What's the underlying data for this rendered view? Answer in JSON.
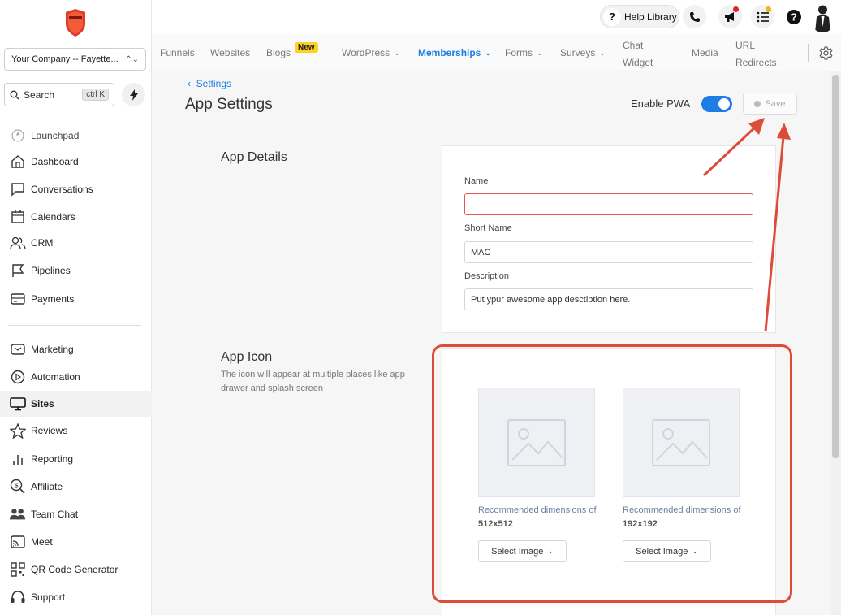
{
  "sidebar": {
    "company": "Your Company -- Fayette...",
    "search_label": "Search",
    "search_shortcut": "ctrl K",
    "items": [
      {
        "label": "Launchpad",
        "icon": "rocket-icon"
      },
      {
        "label": "Dashboard",
        "icon": "home-icon"
      },
      {
        "label": "Conversations",
        "icon": "chat-icon"
      },
      {
        "label": "Calendars",
        "icon": "calendar-icon"
      },
      {
        "label": "CRM",
        "icon": "users-icon"
      },
      {
        "label": "Pipelines",
        "icon": "flag-icon"
      },
      {
        "label": "Payments",
        "icon": "card-icon"
      },
      {
        "label": "Marketing",
        "icon": "mail-icon"
      },
      {
        "label": "Automation",
        "icon": "play-circle-icon"
      },
      {
        "label": "Sites",
        "icon": "monitor-icon",
        "active": true
      },
      {
        "label": "Reviews",
        "icon": "star-icon"
      },
      {
        "label": "Reporting",
        "icon": "bar-chart-icon"
      },
      {
        "label": "Affiliate",
        "icon": "affiliate-icon"
      },
      {
        "label": "Team Chat",
        "icon": "team-icon"
      },
      {
        "label": "Meet",
        "icon": "cast-icon"
      },
      {
        "label": "QR Code Generator",
        "icon": "qr-icon"
      },
      {
        "label": "Support",
        "icon": "headset-icon"
      }
    ]
  },
  "header": {
    "help_label": "Help Library"
  },
  "tabs": [
    {
      "label": "Funnels"
    },
    {
      "label": "Websites"
    },
    {
      "label": "Blogs",
      "badge": "New"
    },
    {
      "label": "WordPress",
      "dropdown": true
    },
    {
      "label": "Memberships",
      "dropdown": true,
      "active": true
    },
    {
      "label": "Forms",
      "dropdown": true
    },
    {
      "label": "Surveys",
      "dropdown": true
    },
    {
      "label_line1": "Chat",
      "label_line2": "Widget"
    },
    {
      "label": "Media"
    },
    {
      "label_line1": "URL",
      "label_line2": "Redirects"
    }
  ],
  "page": {
    "breadcrumb": "Settings",
    "title": "App Settings",
    "pwa_label": "Enable PWA",
    "pwa_enabled": true,
    "save_label": "Save"
  },
  "app_details": {
    "title": "App Details",
    "name_label": "Name",
    "name_value": "",
    "short_name_label": "Short Name",
    "short_name_value": "MAC",
    "description_label": "Description",
    "description_value": "Put ypur awesome app desctiption here."
  },
  "app_icon": {
    "title": "App Icon",
    "description": "The icon will appear at multiple places like app drawer and splash screen",
    "rec_prefix": "Recommended dimensions of",
    "large_size": "512x512",
    "small_size": "192x192",
    "select_label": "Select Image"
  },
  "colors": {
    "accent": "#1e7ce6",
    "annotation": "#dd4b39",
    "error": "#e05a4c"
  }
}
